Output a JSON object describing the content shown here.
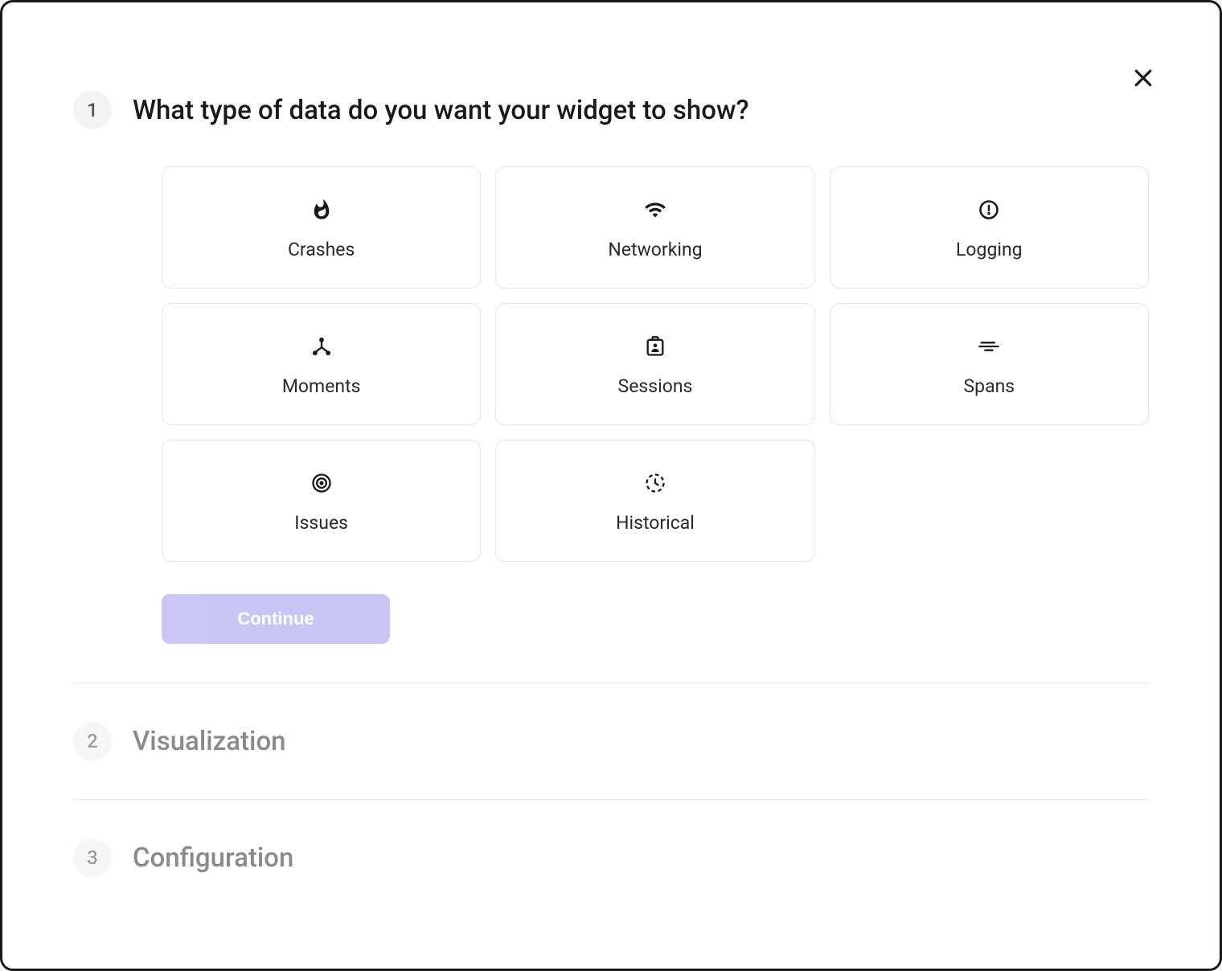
{
  "close": {
    "icon": "close"
  },
  "steps": {
    "step1": {
      "number": "1",
      "title": "What type of data do you want your widget to show?",
      "cards": [
        {
          "icon": "fire",
          "label": "Crashes"
        },
        {
          "icon": "wifi",
          "label": "Networking"
        },
        {
          "icon": "alert",
          "label": "Logging"
        },
        {
          "icon": "hub",
          "label": "Moments"
        },
        {
          "icon": "badge",
          "label": "Sessions"
        },
        {
          "icon": "spans",
          "label": "Spans"
        },
        {
          "icon": "target",
          "label": "Issues"
        },
        {
          "icon": "history",
          "label": "Historical"
        }
      ],
      "continue_label": "Continue"
    },
    "step2": {
      "number": "2",
      "title": "Visualization"
    },
    "step3": {
      "number": "3",
      "title": "Configuration"
    }
  }
}
